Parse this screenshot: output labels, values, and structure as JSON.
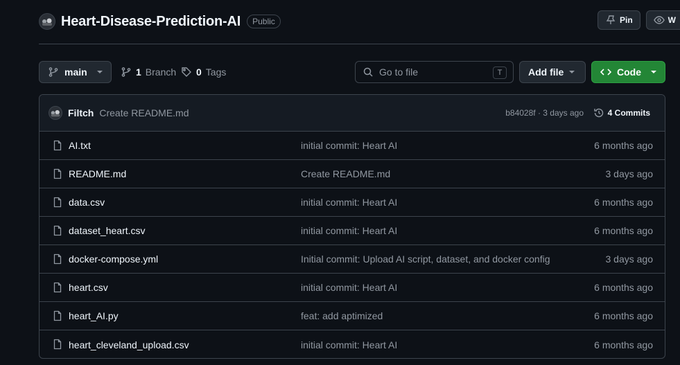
{
  "repo": {
    "name": "Heart-Disease-Prediction-AI",
    "visibility": "Public"
  },
  "header_actions": {
    "pin_label": "Pin",
    "watch_label": "W"
  },
  "toolbar": {
    "branch_label": "main",
    "branches_count": "1",
    "branches_label": "Branch",
    "tags_count": "0",
    "tags_label": "Tags",
    "search_placeholder": "Go to file",
    "search_shortcut": "T",
    "add_file_label": "Add file",
    "code_label": "Code"
  },
  "latest_commit": {
    "author": "Filtch",
    "message": "Create README.md",
    "meta": "b84028f · 3 days ago",
    "commits_label": "4 Commits"
  },
  "files": [
    {
      "name": "AI.txt",
      "commit": "initial commit: Heart AI",
      "date": "6 months ago"
    },
    {
      "name": "README.md",
      "commit": "Create README.md",
      "date": "3 days ago"
    },
    {
      "name": "data.csv",
      "commit": "initial commit: Heart AI",
      "date": "6 months ago"
    },
    {
      "name": "dataset_heart.csv",
      "commit": "initial commit: Heart AI",
      "date": "6 months ago"
    },
    {
      "name": "docker-compose.yml",
      "commit": "Initial commit: Upload AI script, dataset, and docker config",
      "date": "3 days ago"
    },
    {
      "name": "heart.csv",
      "commit": "initial commit: Heart AI",
      "date": "6 months ago"
    },
    {
      "name": "heart_AI.py",
      "commit": "feat: add aptimized",
      "date": "6 months ago"
    },
    {
      "name": "heart_cleveland_upload.csv",
      "commit": "initial commit: Heart AI",
      "date": "6 months ago"
    }
  ],
  "colors": {
    "background": "#0d1117",
    "border": "#3d444d",
    "code_button": "#238636",
    "muted_text": "#9198a1"
  }
}
